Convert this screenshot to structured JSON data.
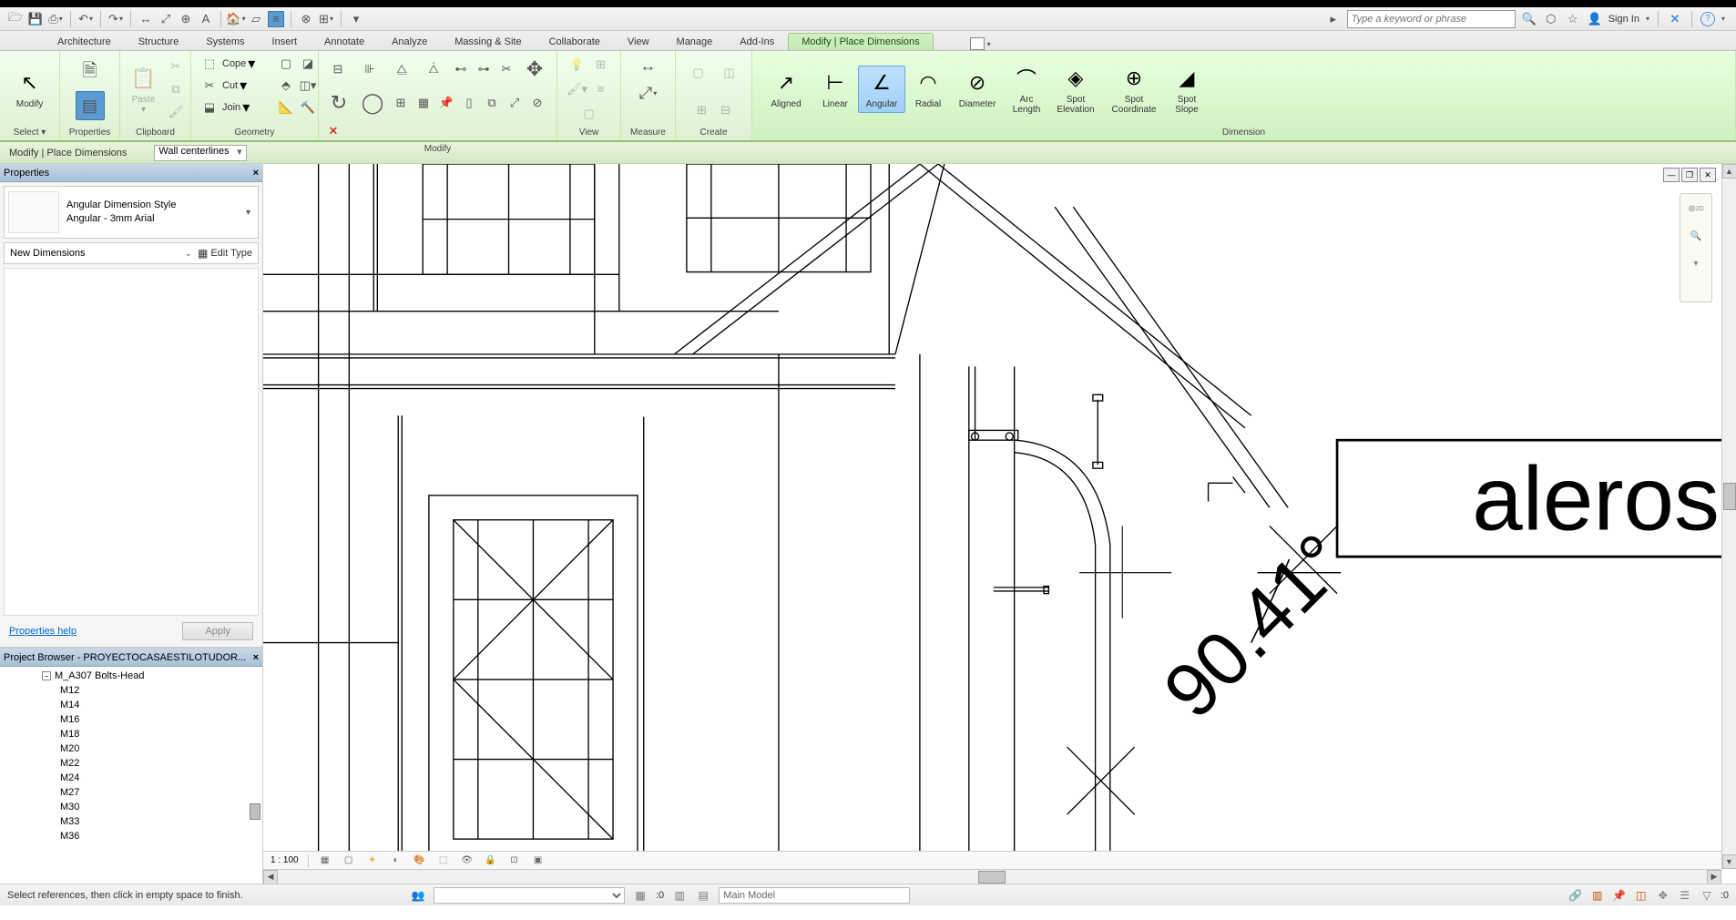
{
  "qat": {
    "search_placeholder": "Type a keyword or phrase",
    "signin": "Sign In"
  },
  "tabs": [
    "Architecture",
    "Structure",
    "Systems",
    "Insert",
    "Annotate",
    "Analyze",
    "Massing & Site",
    "Collaborate",
    "View",
    "Manage",
    "Add-Ins",
    "Modify | Place Dimensions"
  ],
  "active_tab_index": 11,
  "ribbon": {
    "select": {
      "modify": "Modify",
      "select_arrow": "Select",
      "panel": "Select"
    },
    "properties_panel": "Properties",
    "clipboard": {
      "paste": "Paste",
      "panel": "Clipboard"
    },
    "geometry": {
      "cope": "Cope",
      "cut": "Cut",
      "join": "Join",
      "panel": "Geometry"
    },
    "modify_panel": "Modify",
    "view_panel": "View",
    "measure_panel": "Measure",
    "create_panel": "Create",
    "dimension": {
      "aligned": "Aligned",
      "linear": "Linear",
      "angular": "Angular",
      "radial": "Radial",
      "diameter": "Diameter",
      "arc": "Arc\nLength",
      "spot_elev": "Spot\nElevation",
      "spot_coord": "Spot\nCoordinate",
      "spot_slope": "Spot\nSlope",
      "panel": "Dimension"
    }
  },
  "options": {
    "context": "Modify | Place Dimensions",
    "ref_label": "Wall centerlines"
  },
  "properties": {
    "title": "Properties",
    "type_name": "Angular Dimension Style",
    "type_sub": "Angular - 3mm Arial",
    "instance": "New Dimensions",
    "edit_type": "Edit Type",
    "help": "Properties help",
    "apply": "Apply"
  },
  "project_browser": {
    "title": "Project Browser - PROYECTOCASAESTILOTUDOR...",
    "parent": "M_A307 Bolts-Head",
    "items": [
      "M12",
      "M14",
      "M16",
      "M18",
      "M20",
      "M22",
      "M24",
      "M27",
      "M30",
      "M33",
      "M36"
    ]
  },
  "drawing": {
    "angle": "90.41°",
    "callout": "aleros"
  },
  "viewbar": {
    "scale": "1 : 100"
  },
  "status": {
    "hint": "Select references, then click in empty space to finish.",
    "zero": ":0",
    "main_model": "Main Model",
    "filter": ":0"
  }
}
